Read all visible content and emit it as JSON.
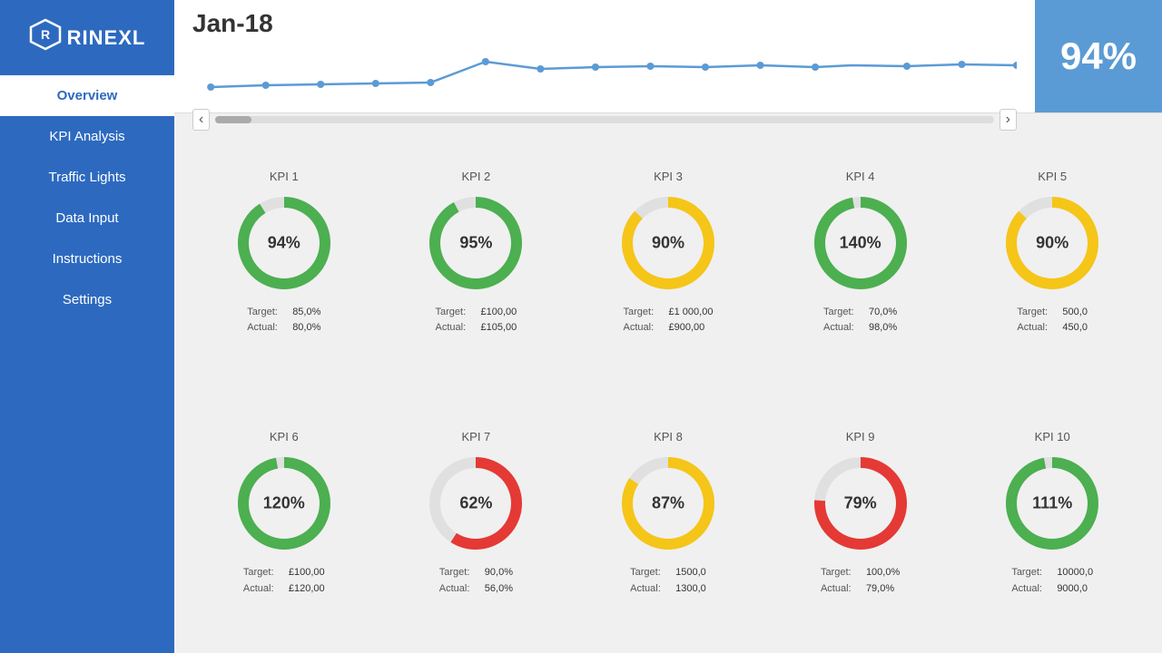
{
  "sidebar": {
    "logo_icon": "⬡",
    "logo_text": "RINEXL",
    "nav_items": [
      {
        "id": "overview",
        "label": "Overview",
        "active": true
      },
      {
        "id": "kpi-analysis",
        "label": "KPI Analysis",
        "active": false
      },
      {
        "id": "traffic-lights",
        "label": "Traffic Lights",
        "active": false
      },
      {
        "id": "data-input",
        "label": "Data Input",
        "active": false
      },
      {
        "id": "instructions",
        "label": "Instructions",
        "active": false
      },
      {
        "id": "settings",
        "label": "Settings",
        "active": false
      }
    ]
  },
  "header": {
    "month": "Jan-18",
    "score": "94%",
    "nav_prev": "‹",
    "nav_next": "›"
  },
  "kpis": [
    {
      "id": "kpi1",
      "label": "KPI 1",
      "value": "94%",
      "color": "#4caf50",
      "pct": 94,
      "bg": "#e0e0e0",
      "target_lbl": "Target:",
      "target_val": "85,0%",
      "actual_lbl": "Actual:",
      "actual_val": "80,0%"
    },
    {
      "id": "kpi2",
      "label": "KPI 2",
      "value": "95%",
      "color": "#4caf50",
      "pct": 95,
      "bg": "#e0e0e0",
      "target_lbl": "Target:",
      "target_val": "£100,00",
      "actual_lbl": "Actual:",
      "actual_val": "£105,00"
    },
    {
      "id": "kpi3",
      "label": "KPI 3",
      "value": "90%",
      "color": "#f5c518",
      "pct": 90,
      "bg": "#e0e0e0",
      "target_lbl": "Target:",
      "target_val": "£1 000,00",
      "actual_lbl": "Actual:",
      "actual_val": "£900,00"
    },
    {
      "id": "kpi4",
      "label": "KPI 4",
      "value": "140%",
      "color": "#4caf50",
      "pct": 100,
      "bg": "#e0e0e0",
      "target_lbl": "Target:",
      "target_val": "70,0%",
      "actual_lbl": "Actual:",
      "actual_val": "98,0%"
    },
    {
      "id": "kpi5",
      "label": "KPI 5",
      "value": "90%",
      "color": "#f5c518",
      "pct": 90,
      "bg": "#e0e0e0",
      "target_lbl": "Target:",
      "target_val": "500,0",
      "actual_lbl": "Actual:",
      "actual_val": "450,0"
    },
    {
      "id": "kpi6",
      "label": "KPI 6",
      "value": "120%",
      "color": "#4caf50",
      "pct": 100,
      "bg": "#e0e0e0",
      "target_lbl": "Target:",
      "target_val": "£100,00",
      "actual_lbl": "Actual:",
      "actual_val": "£120,00"
    },
    {
      "id": "kpi7",
      "label": "KPI 7",
      "value": "62%",
      "color": "#e53935",
      "pct": 62,
      "bg": "#e0e0e0",
      "target_lbl": "Target:",
      "target_val": "90,0%",
      "actual_lbl": "Actual:",
      "actual_val": "56,0%"
    },
    {
      "id": "kpi8",
      "label": "KPI 8",
      "value": "87%",
      "color": "#f5c518",
      "pct": 87,
      "bg": "#e0e0e0",
      "target_lbl": "Target:",
      "target_val": "1500,0",
      "actual_lbl": "Actual:",
      "actual_val": "1300,0"
    },
    {
      "id": "kpi9",
      "label": "KPI 9",
      "value": "79%",
      "color": "#e53935",
      "pct": 79,
      "bg": "#e0e0e0",
      "target_lbl": "Target:",
      "target_val": "100,0%",
      "actual_lbl": "Actual:",
      "actual_val": "79,0%"
    },
    {
      "id": "kpi10",
      "label": "KPI 10",
      "value": "111%",
      "color": "#4caf50",
      "pct": 100,
      "bg": "#e0e0e0",
      "target_lbl": "Target:",
      "target_val": "10000,0",
      "actual_lbl": "Actual:",
      "actual_val": "9000,0"
    }
  ]
}
